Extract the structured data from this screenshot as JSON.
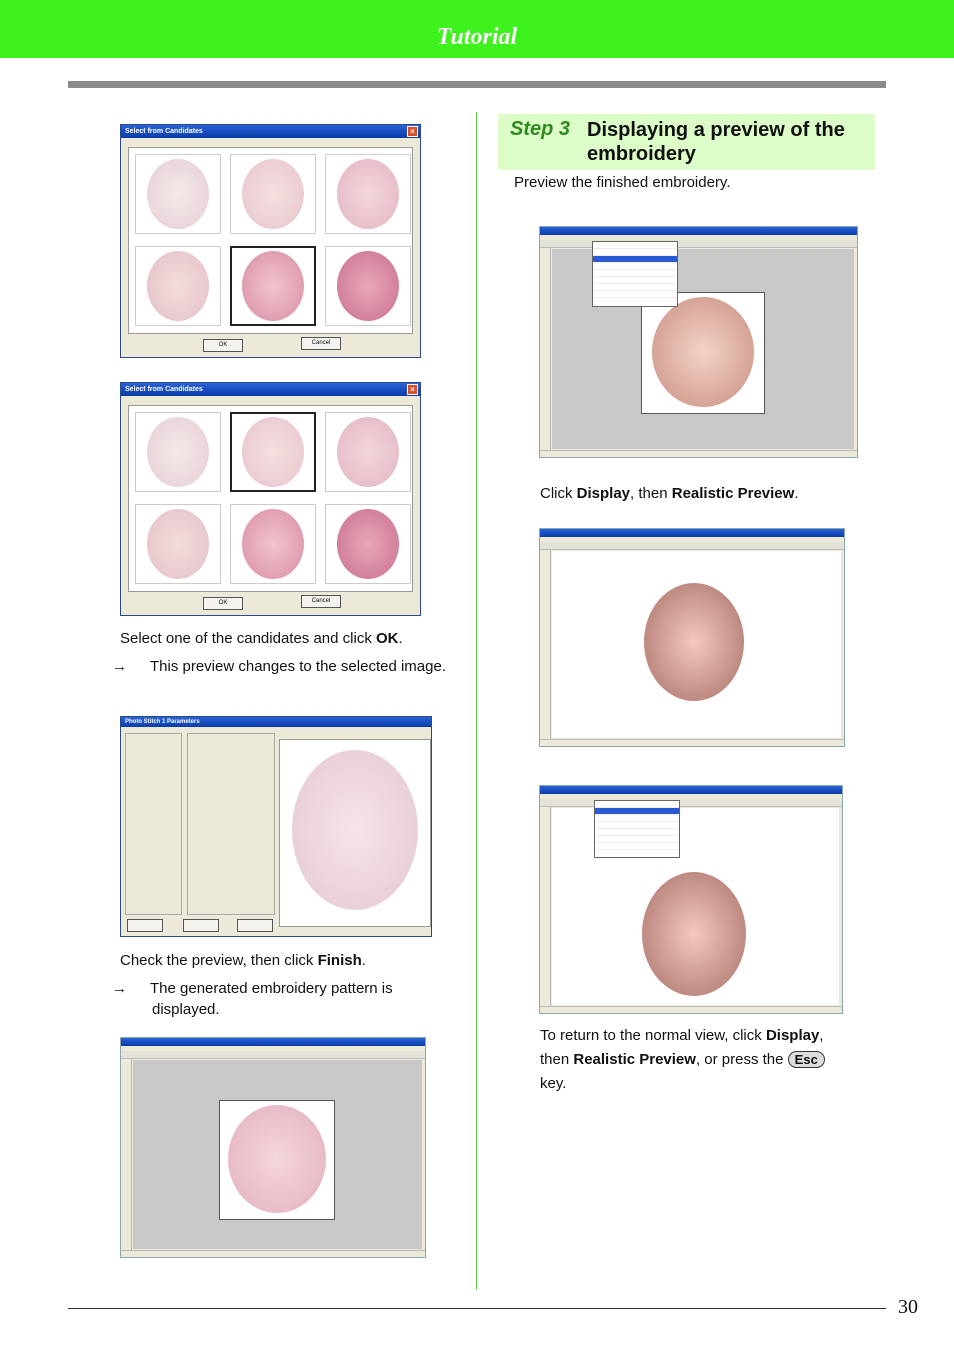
{
  "header": {
    "title": "Tutorial"
  },
  "step": {
    "number": "Step 3",
    "title": "Displaying a preview of the embroidery"
  },
  "dialogs": {
    "candidates_title": "Select from Candidates",
    "ok_label": "OK",
    "cancel_label": "Cancel",
    "params_title": "Photo Stitch 1 Parameters"
  },
  "left": {
    "p1_pre": "Select one of the candidates and click ",
    "p1_bold": "OK",
    "p1_post": ".",
    "arrow": "→",
    "p2": "This preview changes to the selected image.",
    "p3_pre": "Check the preview, then click ",
    "p3_bold": "Finish",
    "p3_post": ".",
    "p4": "The generated embroidery pattern is displayed."
  },
  "right": {
    "intro": "Preview the finished embroidery.",
    "c1_a": "Click ",
    "c1_b": "Display",
    "c1_c": ", then ",
    "c1_d": "Realistic Preview",
    "c1_e": ".",
    "r1": "To return to the normal view, click ",
    "r2": "Display",
    "r3": ",",
    "r4": "then ",
    "r5": "Realistic Preview",
    "r6": ", or press the",
    "esc": "Esc",
    "r7": "key."
  },
  "page_number": "30"
}
